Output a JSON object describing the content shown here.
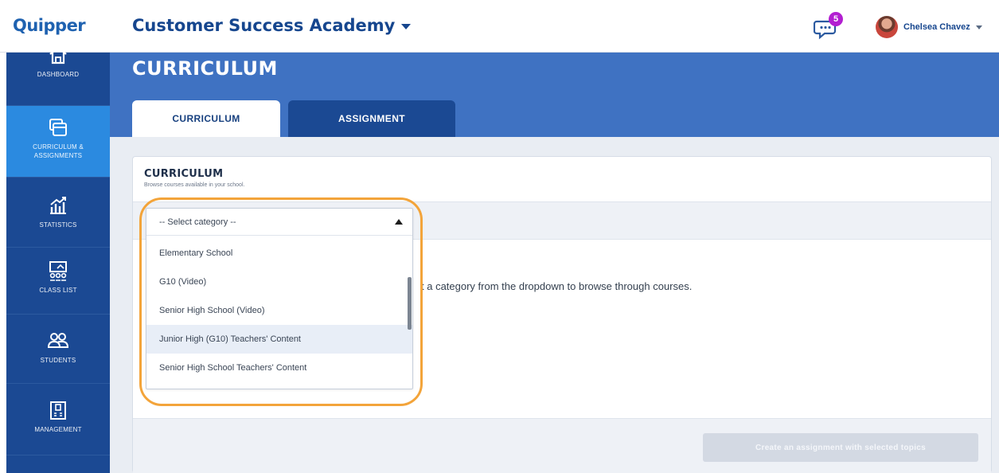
{
  "header": {
    "brand": "Quipper",
    "school_name": "Customer Success Academy",
    "notifications_count": "5",
    "user_name": "Chelsea Chavez"
  },
  "sidebar": {
    "items": [
      {
        "label": "DASHBOARD",
        "icon": "home-icon"
      },
      {
        "label": "CURRICULUM & ASSIGNMENTS",
        "icon": "curriculum-icon",
        "active": true
      },
      {
        "label": "STATISTICS",
        "icon": "statistics-icon"
      },
      {
        "label": "CLASS LIST",
        "icon": "class-list-icon"
      },
      {
        "label": "STUDENTS",
        "icon": "students-icon"
      },
      {
        "label": "MANAGEMENT",
        "icon": "management-icon"
      }
    ]
  },
  "main": {
    "page_title": "CURRICULUM",
    "tabs": [
      {
        "label": "CURRICULUM",
        "active": true
      },
      {
        "label": "ASSIGNMENT",
        "active": false
      }
    ],
    "card": {
      "title": "CURRICULUM",
      "subtitle": "Browse courses available in your school.",
      "empty_message": "t a category from the dropdown to browse through courses.",
      "create_button": "Create an assignment with selected topics"
    }
  },
  "dropdown": {
    "selected": "-- Select category --",
    "options": [
      {
        "label": "Elementary School"
      },
      {
        "label": "G10 (Video)"
      },
      {
        "label": "Senior High School (Video)"
      },
      {
        "label": "Junior High (G10) Teachers' Content",
        "highlighted": true
      },
      {
        "label": "Senior High School Teachers' Content"
      }
    ]
  },
  "colors": {
    "brand_blue": "#1f62b0",
    "sidebar_bg": "#1b4993",
    "sidebar_active": "#2b8ae0",
    "header_bg": "#3f72c2",
    "badge": "#b21fd1",
    "annotation_ring": "#f3a43a"
  }
}
